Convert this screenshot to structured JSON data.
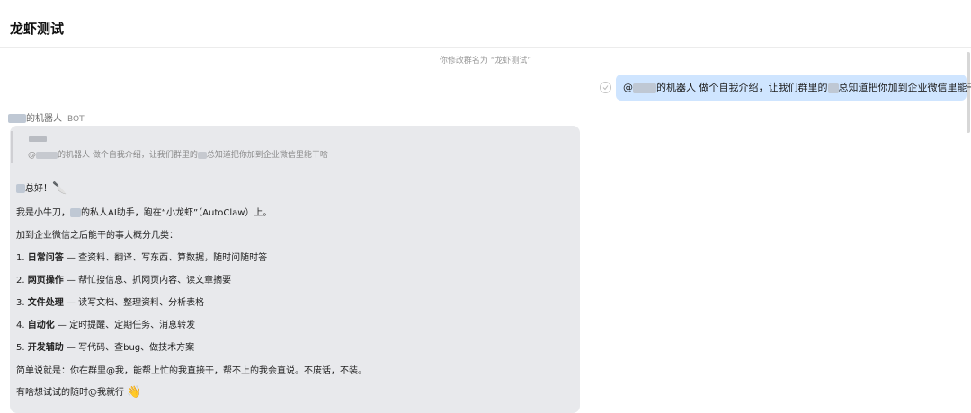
{
  "header": {
    "title": "龙虾测试"
  },
  "system_message": "你修改群名为 “龙虾测试”",
  "outgoing": {
    "prefix": "@",
    "text": "的机器人 做个自我介绍，让我们群里的",
    "text2": "总知道把你加到企业微信里能干啥"
  },
  "sender": {
    "name": "的机器人",
    "badge": "BOT"
  },
  "quote": {
    "prefix": "@",
    "text": "的机器人 做个自我介绍，让我们群里的",
    "text2": "总知道把你加到企业微信里能干啥"
  },
  "reply": {
    "greeting": "总好！",
    "intro_a": "我是小牛刀，",
    "intro_b": "的私人AI助手，跑在“小龙虾”（AutoClaw）上。",
    "lead": "加到企业微信之后能干的事大概分几类：",
    "items": [
      {
        "num": "1.",
        "title": "日常问答",
        "desc": " — 查资料、翻译、写东西、算数据，随时问随时答"
      },
      {
        "num": "2.",
        "title": "网页操作",
        "desc": " — 帮忙搜信息、抓网页内容、读文章摘要"
      },
      {
        "num": "3.",
        "title": "文件处理",
        "desc": " — 读写文档、整理资料、分析表格"
      },
      {
        "num": "4.",
        "title": "自动化",
        "desc": " — 定时提醒、定期任务、消息转发"
      },
      {
        "num": "5.",
        "title": "开发辅助",
        "desc": " — 写代码、查bug、做技术方案"
      }
    ],
    "summary": "简单说就是：你在群里@我，能帮上忙的我直接干，帮不上的我会直说。不废话，不装。",
    "closing": "有啥想试试的随时@我就行",
    "greeting_emoji": "🔪",
    "closing_emoji": "👋"
  },
  "icons": {
    "status": "check-circle-icon"
  }
}
